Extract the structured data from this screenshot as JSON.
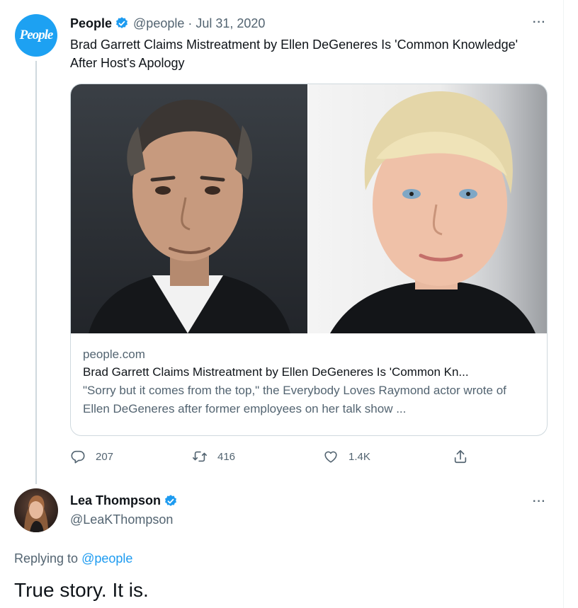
{
  "tweet1": {
    "avatar_text": "People",
    "name": "People",
    "handle": "@people",
    "date": "· Jul 31, 2020",
    "text": "Brad Garrett Claims Mistreatment by Ellen DeGeneres Is 'Common Knowledge' After Host's Apology",
    "card": {
      "domain": "people.com",
      "title": "Brad Garrett Claims Mistreatment by Ellen DeGeneres Is 'Common Kn...",
      "description": "\"Sorry but it comes from the top,\" the Everybody Loves Raymond actor wrote of Ellen DeGeneres after former employees on her talk show ..."
    },
    "actions": {
      "reply_count": "207",
      "retweet_count": "416",
      "like_count": "1.4K"
    }
  },
  "tweet2": {
    "name": "Lea Thompson",
    "handle": "@LeaKThompson",
    "replying_prefix": "Replying to",
    "replying_handle": "@people",
    "text": "True story. It is."
  },
  "more_label": "···",
  "colors": {
    "accent": "#1d9bf0",
    "secondary_text": "#536471",
    "border": "#cfd9de"
  },
  "icons": [
    "verified-badge-icon",
    "reply-icon",
    "retweet-icon",
    "like-icon",
    "share-icon",
    "more-icon"
  ]
}
